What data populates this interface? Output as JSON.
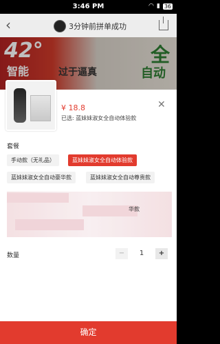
{
  "status": {
    "time": "3:46 PM",
    "battery": "36"
  },
  "nav": {
    "back_icon": "chevron-left-icon",
    "title": "3分钟前拼单成功"
  },
  "banner": {
    "line1": "42°",
    "line2": "智能",
    "line3": "过于逼真",
    "line4": "全",
    "line5": "自动"
  },
  "product": {
    "price": "¥ 18.8",
    "selected": "已选: 蓝妹妹淑女全自动体验款"
  },
  "spec": {
    "label": "套餐",
    "options": [
      "手动款（无礼品）",
      "蓝妹妹淑女全自动体验款",
      "蓝妹妹淑女全自动豪华款",
      "蓝妹妹淑女全自动尊贵款"
    ],
    "partial_text": "华款"
  },
  "quantity": {
    "label": "数量",
    "value": "1",
    "minus": "−",
    "plus": "+"
  },
  "confirm": "确定",
  "colors": {
    "accent": "#e23b2e"
  }
}
